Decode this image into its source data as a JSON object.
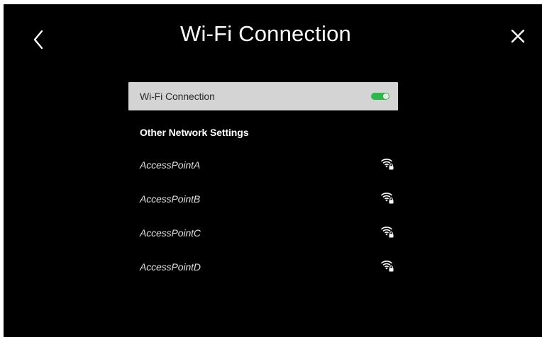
{
  "header": {
    "title": "Wi-Fi Connection"
  },
  "wifi": {
    "toggle_label": "Wi-Fi Connection",
    "enabled": true,
    "toggle_color": "#2db84d"
  },
  "other_settings": {
    "label": "Other Network Settings"
  },
  "access_points": [
    {
      "name": "AccessPointA",
      "icon": "wifi-locked-icon"
    },
    {
      "name": "AccessPointB",
      "icon": "wifi-locked-icon"
    },
    {
      "name": "AccessPointC",
      "icon": "wifi-locked-icon"
    },
    {
      "name": "AccessPointD",
      "icon": "wifi-locked-icon"
    }
  ],
  "icons": {
    "back": "chevron-left-icon",
    "close": "close-icon"
  },
  "colors": {
    "background": "#000000",
    "selected_row": "#d4d4d4",
    "accent_green": "#2db84d"
  }
}
